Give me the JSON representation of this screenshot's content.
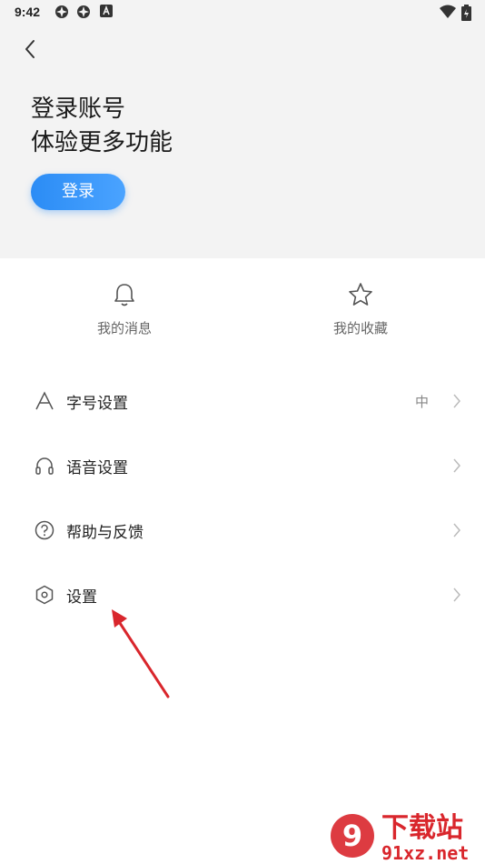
{
  "status": {
    "time": "9:42"
  },
  "header": {
    "title_line1": "登录账号",
    "title_line2": "体验更多功能",
    "login_label": "登录"
  },
  "quick_actions": [
    {
      "label": "我的消息",
      "icon": "bell-icon"
    },
    {
      "label": "我的收藏",
      "icon": "star-icon"
    }
  ],
  "menu": [
    {
      "label": "字号设置",
      "value": "中",
      "icon": "font-size-icon"
    },
    {
      "label": "语音设置",
      "value": "",
      "icon": "headphones-icon"
    },
    {
      "label": "帮助与反馈",
      "value": "",
      "icon": "help-circle-icon"
    },
    {
      "label": "设置",
      "value": "",
      "icon": "hexagon-settings-icon"
    }
  ],
  "watermark": {
    "text_main": "下载站",
    "text_sub": "91xz.net",
    "logo": "9"
  },
  "colors": {
    "accent": "#2b8cf5",
    "header_bg": "#f3f3f3",
    "annotation": "#d9262c"
  }
}
